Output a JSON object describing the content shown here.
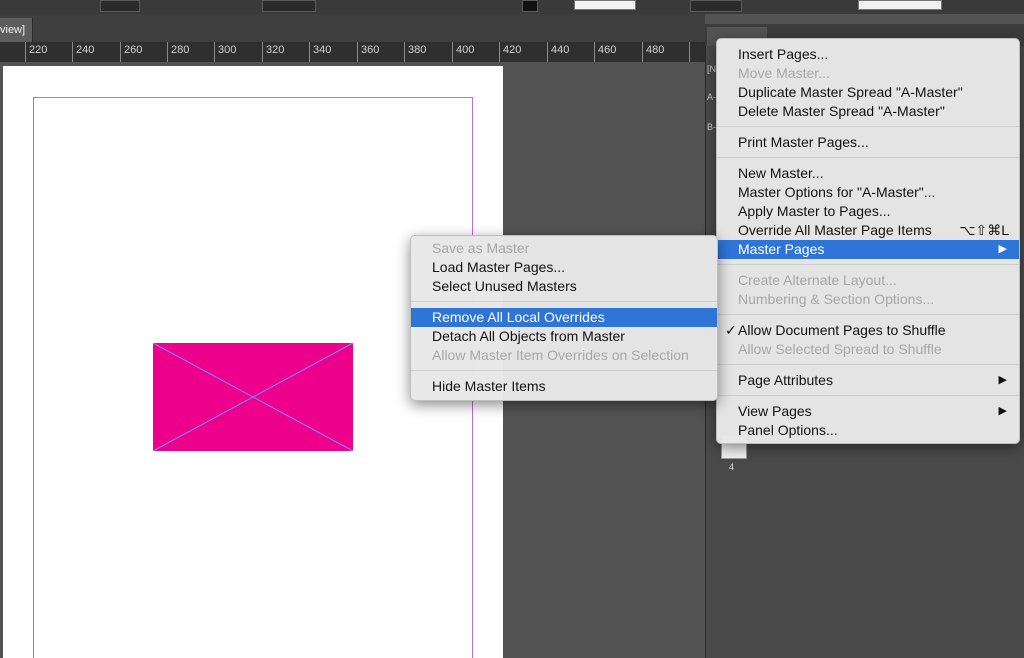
{
  "document": {
    "tab_label": "view]"
  },
  "ruler": {
    "labels": [
      "220",
      "240",
      "260",
      "280",
      "300",
      "320",
      "340",
      "360",
      "380",
      "400",
      "420",
      "440",
      "460",
      "480"
    ]
  },
  "pages_panel": {
    "row_n": "[N",
    "row_a": "A-",
    "row_b": "B-",
    "page_number": "4"
  },
  "colors": {
    "frame_fill": "#ec008c",
    "highlight": "#2f74d7",
    "margin_guide": "#c36bd6"
  },
  "panel_menu": {
    "insert_pages": "Insert Pages...",
    "move_master": "Move Master...",
    "duplicate_master_spread": "Duplicate Master Spread \"A-Master\"",
    "delete_master_spread": "Delete Master Spread \"A-Master\"",
    "print_master_pages": "Print Master Pages...",
    "new_master": "New Master...",
    "master_options": "Master Options for \"A-Master\"...",
    "apply_master": "Apply Master to Pages...",
    "override_all": "Override All Master Page Items",
    "override_all_shortcut": "⌥⇧⌘L",
    "master_pages": "Master Pages",
    "create_alternate_layout": "Create Alternate Layout...",
    "numbering_section": "Numbering & Section Options...",
    "check_mark": "✓",
    "allow_document_shuffle": "Allow Document Pages to Shuffle",
    "allow_spread_shuffle": "Allow Selected Spread to Shuffle",
    "page_attributes": "Page Attributes",
    "view_pages": "View Pages",
    "panel_options": "Panel Options...",
    "submenu_arrow": "▶"
  },
  "master_submenu": {
    "save_as_master": "Save as Master",
    "load_master_pages": "Load Master Pages...",
    "select_unused_masters": "Select Unused Masters",
    "remove_local_overrides": "Remove All Local Overrides",
    "detach_all_objects": "Detach All Objects from Master",
    "allow_master_overrides": "Allow Master Item Overrides on Selection",
    "hide_master_items": "Hide Master Items"
  }
}
